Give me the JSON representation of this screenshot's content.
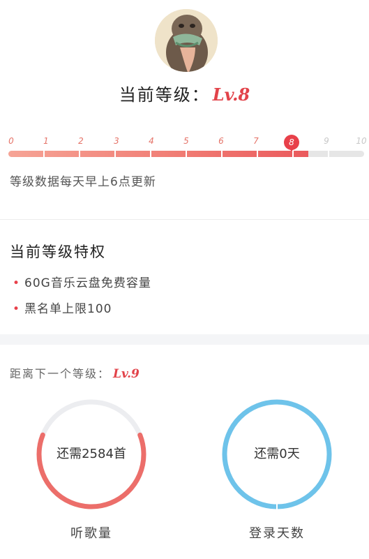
{
  "profile": {
    "current_level_label": "当前等级：",
    "current_level_badge": "Lv.8"
  },
  "level_progress": {
    "ticks": [
      "0",
      "1",
      "2",
      "3",
      "4",
      "5",
      "6",
      "7",
      "8",
      "9",
      "10"
    ],
    "current_level": 8,
    "max_level": 10,
    "progress_fraction": 0.843,
    "update_note": "等级数据每天早上6点更新"
  },
  "privileges": {
    "title": "当前等级特权",
    "items": [
      "60G音乐云盘免费容量",
      "黑名单上限100"
    ]
  },
  "next_level": {
    "label": "距离下一个等级：",
    "badge": "Lv.9"
  },
  "requirements": [
    {
      "text": "还需2584首",
      "caption": "听歌量",
      "progress": 0.62,
      "color": "#ec6e6a"
    },
    {
      "text": "还需0天",
      "caption": "登录天数",
      "progress": 1.0,
      "color": "#6ec3ea"
    }
  ],
  "colors": {
    "accent": "#e8404a",
    "track": "#e6e6e6"
  }
}
